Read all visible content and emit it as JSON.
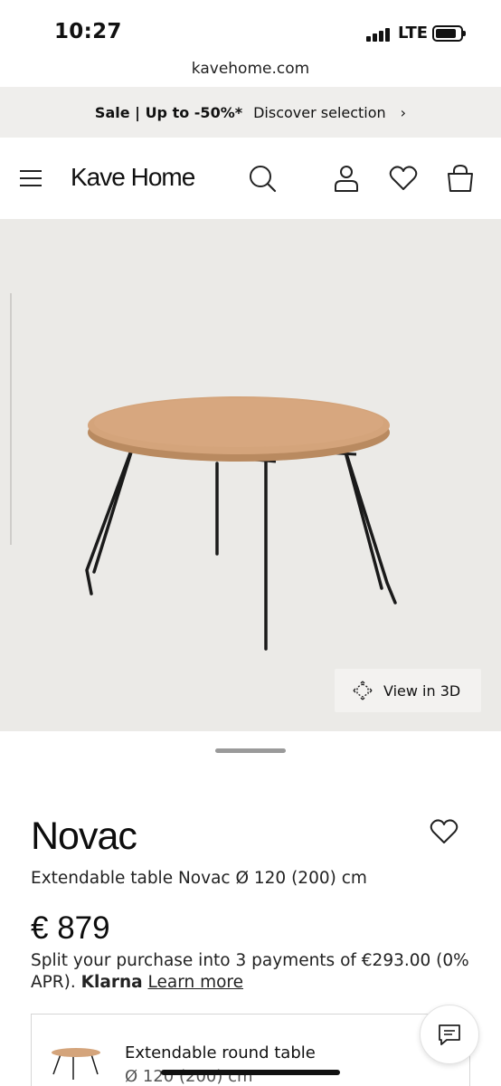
{
  "status": {
    "time": "10:27",
    "network": "LTE",
    "battery_level": 0.85
  },
  "browser": {
    "url": "kavehome.com"
  },
  "promo": {
    "sale": "Sale | Up to -50%*",
    "link": "Discover selection",
    "chevron": "›"
  },
  "header": {
    "logo": "Kave Home",
    "icons": [
      "menu-icon",
      "search-icon",
      "user-icon",
      "heart-icon",
      "bag-icon"
    ]
  },
  "hero": {
    "view_3d": "View in 3D"
  },
  "product": {
    "name": "Novac",
    "subtitle": "Extendable table Novac Ø 120 (200) cm",
    "price": "€ 879",
    "split_text": "Split your purchase into 3 payments of €293.00 (0% APR).",
    "klarna": "Klarna",
    "learn_more": "Learn more"
  },
  "variant": {
    "name": "Extendable round table",
    "size": "Ø 120 (200) cm"
  },
  "colors": {
    "promo_bg": "#efeeec",
    "hero_bg": "#ebeae7",
    "wood": "#d2a27a",
    "metal": "#1a1a1a"
  }
}
